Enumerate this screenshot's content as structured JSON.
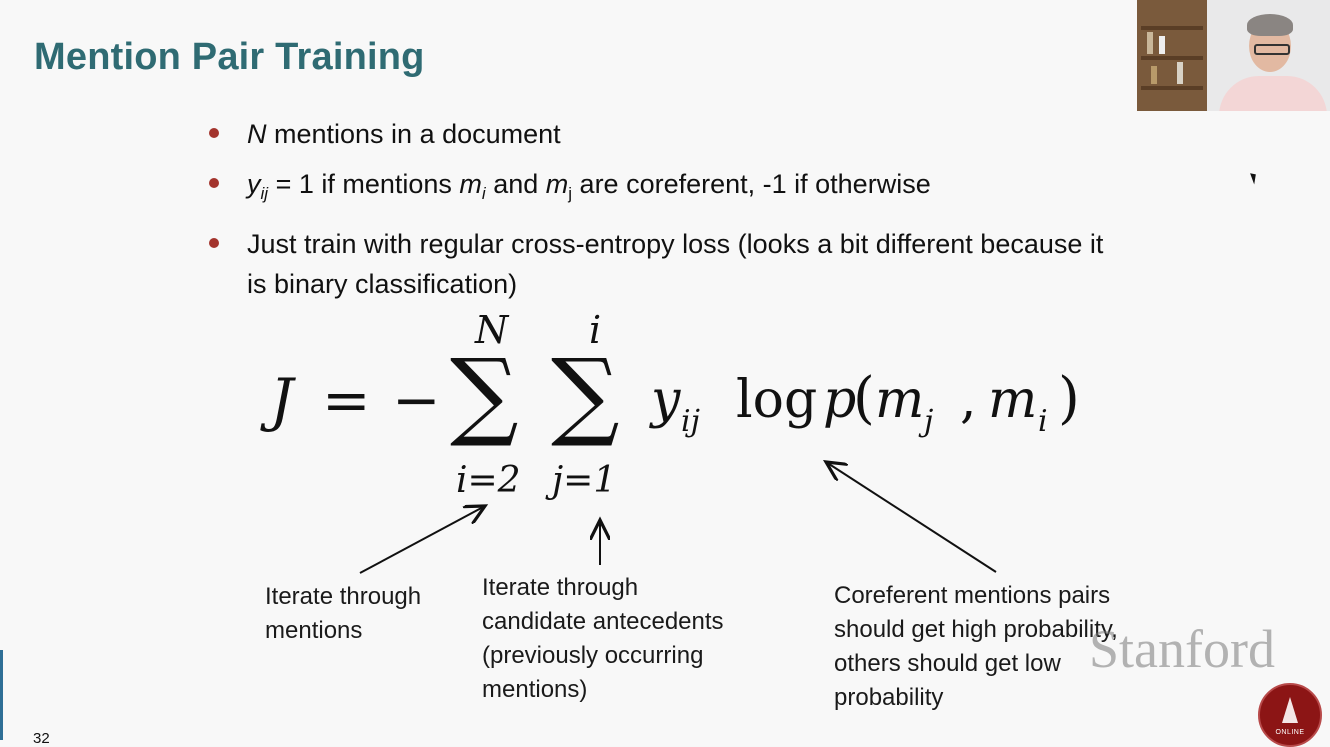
{
  "slide": {
    "title": "Mention Pair Training",
    "page_number": "32",
    "bullets": [
      {
        "parts": [
          {
            "t": "N",
            "i": true
          },
          {
            "t": " mentions in a document"
          }
        ]
      },
      {
        "parts": [
          {
            "t": "y",
            "i": true
          },
          {
            "t": "ij",
            "sub": true,
            "i": true
          },
          {
            "t": " = 1 if mentions "
          },
          {
            "t": "m",
            "i": true
          },
          {
            "t": "i",
            "sub": true,
            "i": true
          },
          {
            "t": " and "
          },
          {
            "t": "m",
            "i": true
          },
          {
            "t": "j",
            "sub": true
          },
          {
            "t": " are coreferent, -1 if otherwise"
          }
        ]
      },
      {
        "parts": [
          {
            "t": "Just train with regular cross-entropy loss (looks a bit different because it is binary classification)"
          }
        ]
      }
    ],
    "formula": {
      "lhs": "J",
      "equals": "=",
      "minus": "−",
      "sum1_upper": "N",
      "sum1_lower": "i=2",
      "sum2_upper": "i",
      "sum2_lower": "j=1",
      "sigma": "∑",
      "y": "y",
      "y_sub": "ij",
      "log": "log",
      "p": "p",
      "open": "(",
      "m1": "m",
      "m1_sub": "j",
      "comma": ",",
      "m2": "m",
      "m2_sub": "i",
      "close": ")"
    },
    "annotations": {
      "mentions": [
        "Iterate through",
        "mentions"
      ],
      "antecedents": [
        "Iterate through",
        "candidate antecedents",
        "(previously occurring",
        "mentions)"
      ],
      "probability": [
        "Coreferent mentions pairs",
        "should get high probability,",
        "others should get low",
        "probability"
      ]
    },
    "brand": "Stanford",
    "seal_text": "ONLINE"
  }
}
